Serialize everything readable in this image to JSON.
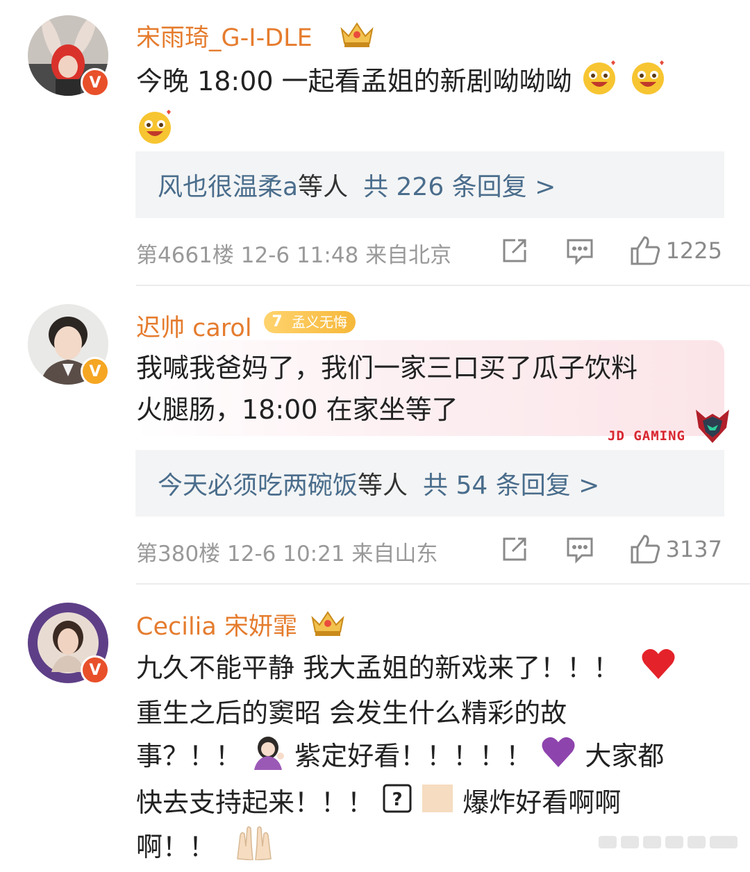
{
  "comments": [
    {
      "username": "宋雨琦_G-I-DLE",
      "text_line1": "今晚 18:00 一起看孟姐的新剧呦呦呦",
      "reply": {
        "names": "风也很温柔a",
        "suffix": "等人",
        "count": "共 226 条回复 >"
      },
      "meta": "第4661楼 12-6 11:48  来自北京",
      "likes": "1225"
    },
    {
      "username": "迟帅 carol",
      "tag_level": "7",
      "tag_text": "孟义无悔",
      "text_line1": "我喊我爸妈了，我们一家三口买了瓜子饮料",
      "text_line2": "火腿肠，18:00 在家坐等了",
      "watermark": "JD GAMING",
      "reply": {
        "names": "今天必须吃两碗饭",
        "suffix": "等人",
        "count": "共 54 条回复 >"
      },
      "meta": "第380楼 12-6 10:21  来自山东",
      "likes": "3137"
    },
    {
      "username": "Cecilia 宋妍霏",
      "text_line1": "九久不能平静 我大孟姐的新戏来了！！！",
      "text_line2": "重生之后的窦昭 会发生什么精彩的故",
      "text_line3a": "事？！！",
      "text_line3b": "紫定好看！！！！！",
      "text_line3c": "大家都",
      "text_line4a": "快去支持起来！！！",
      "text_line4b": "爆炸好看啊啊",
      "text_line5": "啊！！"
    }
  ],
  "icons": [
    "share-icon",
    "comment-icon",
    "like-icon",
    "verified-badge-icon",
    "crown-badge-icon"
  ],
  "colors": {
    "username": "#e57c2e",
    "reply_link": "#4a6d8c",
    "meta": "#999999",
    "reply_bg": "#f3f4f5"
  }
}
